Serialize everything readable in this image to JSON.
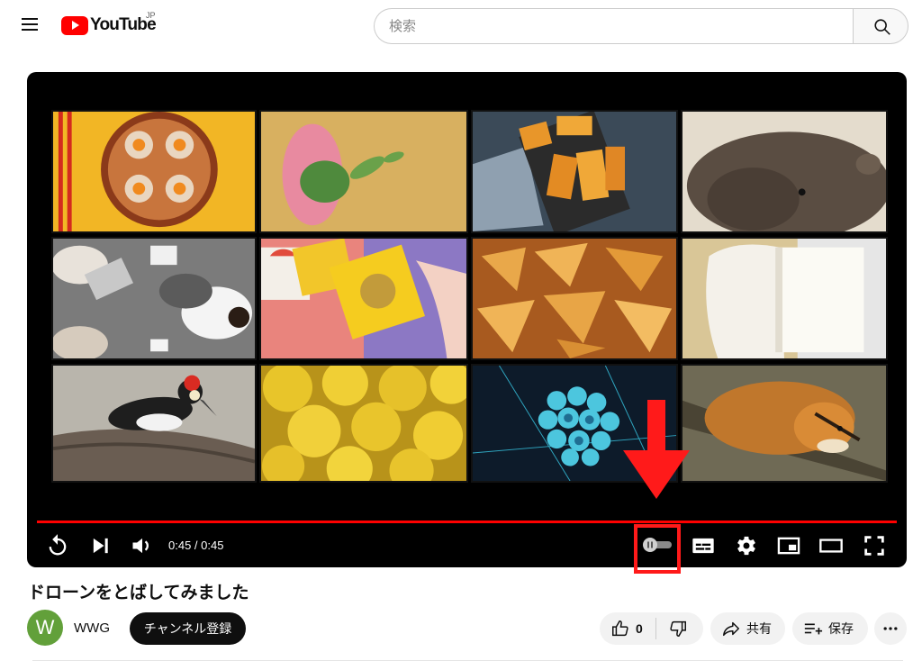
{
  "header": {
    "logo_text": "YouTube",
    "region": "JP",
    "search_placeholder": "検索"
  },
  "player": {
    "time": "0:45 / 0:45",
    "progress_fraction": 1.0,
    "autoplay_state": "off",
    "thumbnails": [
      "dumplings-tile",
      "pink-flower-tile",
      "fried-tofu-tile",
      "wombat-tile",
      "meeting-tile",
      "gift-box-tile",
      "chips-tile",
      "cheese-tile",
      "woodpecker-tile",
      "banana-chips-tile",
      "molecule-tile",
      "squirrel-tile"
    ]
  },
  "video": {
    "title": "ドローンをとばしてみました",
    "channel_initial": "W",
    "channel_name": "WWG",
    "subscribe_label": "チャンネル登録",
    "like_count": "0",
    "share_label": "共有",
    "save_label": "保存"
  },
  "colors": {
    "accent": "#ff0000",
    "annotation": "#ff1a1a",
    "avatar": "#62a03a"
  }
}
